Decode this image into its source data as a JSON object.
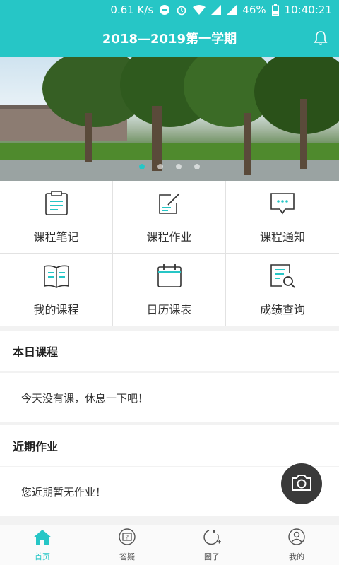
{
  "status": {
    "speed": "0.61 K/s",
    "battery": "46%",
    "time": "10:40:21"
  },
  "header": {
    "title": "2018—2019第一学期"
  },
  "colors": {
    "accent": "#26c6c6",
    "fab": "#3a3a3a"
  },
  "grid": {
    "items": [
      {
        "label": "课程笔记",
        "icon": "notes-icon"
      },
      {
        "label": "课程作业",
        "icon": "homework-edit-icon"
      },
      {
        "label": "课程通知",
        "icon": "notice-message-icon"
      },
      {
        "label": "我的课程",
        "icon": "open-book-icon"
      },
      {
        "label": "日历课表",
        "icon": "calendar-icon"
      },
      {
        "label": "成绩查询",
        "icon": "grade-search-icon"
      }
    ]
  },
  "today": {
    "title": "本日课程",
    "message": "今天没有课，休息一下吧！"
  },
  "homework": {
    "title": "近期作业",
    "message": "您近期暂无作业！"
  },
  "tabs": [
    {
      "label": "首页",
      "icon": "home-icon"
    },
    {
      "label": "答疑",
      "icon": "qa-icon"
    },
    {
      "label": "圈子",
      "icon": "circle-icon"
    },
    {
      "label": "我的",
      "icon": "profile-icon"
    }
  ]
}
